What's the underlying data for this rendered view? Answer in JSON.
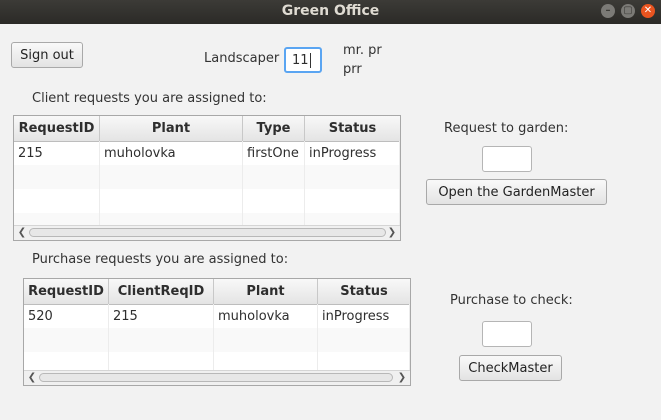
{
  "window": {
    "title": "Green Office"
  },
  "header": {
    "sign_out_label": "Sign out",
    "landscaper_label": "Landscaper",
    "landscaper_value": "11",
    "landscaper_name_line1": "mr. pr",
    "landscaper_name_line2": "prr"
  },
  "client_requests": {
    "heading": "Client requests you are assigned to:",
    "columns": [
      "RequestID",
      "Plant",
      "Type",
      "Status"
    ],
    "rows": [
      [
        "215",
        "muholovka",
        "firstOne",
        "inProgress"
      ]
    ]
  },
  "garden": {
    "label": "Request to garden:",
    "input_value": "",
    "button_label": "Open the GardenMaster"
  },
  "purchase_requests": {
    "heading": "Purchase requests you are assigned to:",
    "columns": [
      "RequestID",
      "ClientReqID",
      "Plant",
      "Status"
    ],
    "rows": [
      [
        "520",
        "215",
        "muholovka",
        "inProgress"
      ]
    ]
  },
  "purchase": {
    "label": "Purchase to check:",
    "input_value": "",
    "button_label": "CheckMaster"
  },
  "icons": {
    "minimize": "minimize-icon",
    "maximize": "maximize-icon",
    "close": "close-icon",
    "scroll_left": "chevron-left-icon",
    "scroll_right": "chevron-right-icon"
  }
}
